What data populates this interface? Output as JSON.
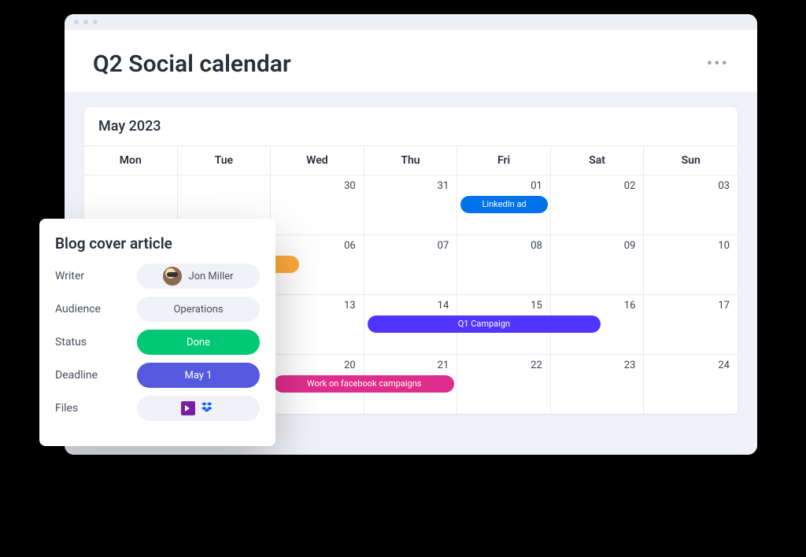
{
  "header": {
    "title": "Q2 Social calendar"
  },
  "calendar": {
    "month": "May 2023",
    "dayNames": [
      "Mon",
      "Tue",
      "Wed",
      "Thu",
      "Fri",
      "Sat",
      "Sun"
    ],
    "rows": [
      [
        "",
        "",
        "30",
        "31",
        "01",
        "02",
        "03"
      ],
      [
        "",
        "",
        "06",
        "07",
        "08",
        "09",
        "10"
      ],
      [
        "",
        "",
        "13",
        "14",
        "15",
        "16",
        "17"
      ],
      [
        "",
        "",
        "20",
        "21",
        "22",
        "23",
        "24"
      ]
    ]
  },
  "events": {
    "e1": "LinkedIn ad",
    "e2": "Blog cover article",
    "e3": "Q1 Campaign",
    "e4": "Work on facebook campaigns"
  },
  "card": {
    "title": "Blog cover article",
    "fields": {
      "writer_label": "Writer",
      "writer_value": "Jon Miller",
      "audience_label": "Audience",
      "audience_value": "Operations",
      "status_label": "Status",
      "status_value": "Done",
      "deadline_label": "Deadline",
      "deadline_value": "May 1",
      "files_label": "Files"
    }
  }
}
